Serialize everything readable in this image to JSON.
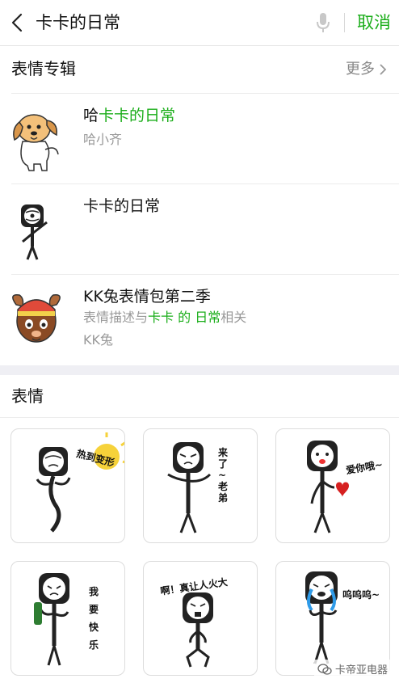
{
  "header": {
    "query": "卡卡的日常",
    "cancel_label": "取消"
  },
  "albums_section": {
    "title": "表情专辑",
    "more_label": "更多",
    "items": [
      {
        "name_prefix": "哈",
        "name_highlight": "卡卡的日常",
        "author": "哈小齐"
      },
      {
        "name_highlight": "卡卡的日常"
      },
      {
        "name": "KK兔表情包第二季",
        "desc_prefix": "表情描述与",
        "desc_hl1": "卡卡",
        "desc_mid": " 的 ",
        "desc_hl2": "日常",
        "desc_suffix": "相关",
        "author": "KK兔"
      }
    ]
  },
  "stickers_section": {
    "title": "表情",
    "items": [
      {
        "caption": "热到变形"
      },
      {
        "caption": "来了~老弟"
      },
      {
        "caption": "爱你哦~"
      },
      {
        "caption": "我要快乐"
      },
      {
        "caption": "啊！真让人火大"
      },
      {
        "caption": "呜呜呜~"
      }
    ]
  },
  "watermark": "卡帝亚电器",
  "colors": {
    "accent": "#1aad19",
    "muted": "#888888",
    "divider": "#ececec"
  }
}
